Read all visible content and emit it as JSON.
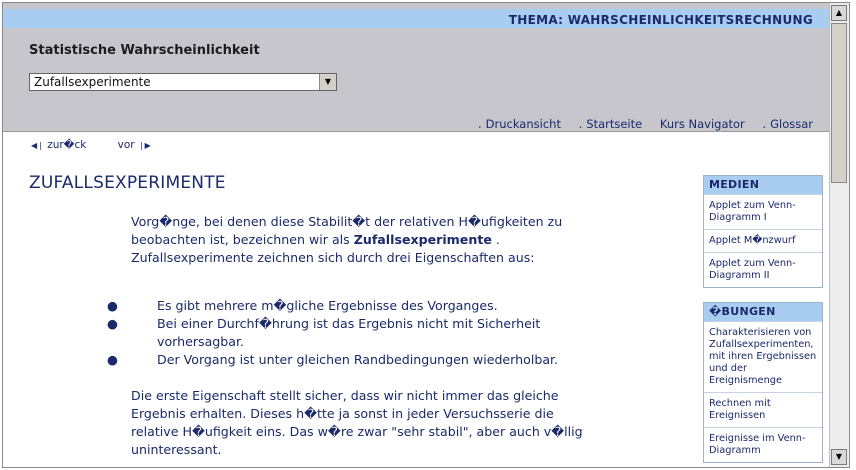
{
  "header": {
    "topic": "THEMA: WAHRSCHEINLICHKEITSRECHNUNG",
    "site_title": "Statistische Wahrscheinlichkeit",
    "chapter_select": {
      "value": "Zufallsexperimente"
    },
    "nav": [
      {
        "label": "Druckansicht"
      },
      {
        "label": "Startseite"
      },
      {
        "label": "Kurs Navigator"
      },
      {
        "label": "Glossar"
      }
    ]
  },
  "pager": {
    "back_label": "zur�ck",
    "next_label": "vor"
  },
  "main": {
    "title": "ZUFALLSEXPERIMENTE",
    "intro_before": "Vorg�nge, bei denen diese Stabilit�t der relativen H�ufigkeiten zu beobachten ist, bezeichnen wir als ",
    "intro_term": "Zufallsexperimente",
    "intro_after": " . Zufallsexperimente zeichnen sich durch drei Eigenschaften aus:",
    "bullets": [
      "Es gibt mehrere m�gliche Ergebnisse des Vorganges.",
      "Bei einer Durchf�hrung ist das Ergebnis nicht mit Sicherheit vorhersagbar.",
      "Der Vorgang ist unter gleichen Randbedingungen wiederholbar."
    ],
    "paragraph": "Die erste Eigenschaft stellt sicher, dass wir nicht immer das gleiche Ergebnis erhalten. Dieses h�tte ja sonst in jeder Versuchsserie die relative H�ufigkeit eins. Das w�re zwar \"sehr stabil\", aber auch v�llig uninteressant."
  },
  "sidebar": {
    "medien": {
      "title": "MEDIEN",
      "items": [
        "Applet zum Venn-Diagramm I",
        "Applet M�nzwurf",
        "Applet zum Venn-Diagramm II"
      ]
    },
    "uebungen": {
      "title": "�BUNGEN",
      "items": [
        "Charakterisieren von Zufallsexperimenten, mit ihren Ergebnissen und der Ereignismenge",
        "Rechnen mit Ereignissen",
        "Ereignisse im Venn-Diagramm"
      ]
    }
  }
}
